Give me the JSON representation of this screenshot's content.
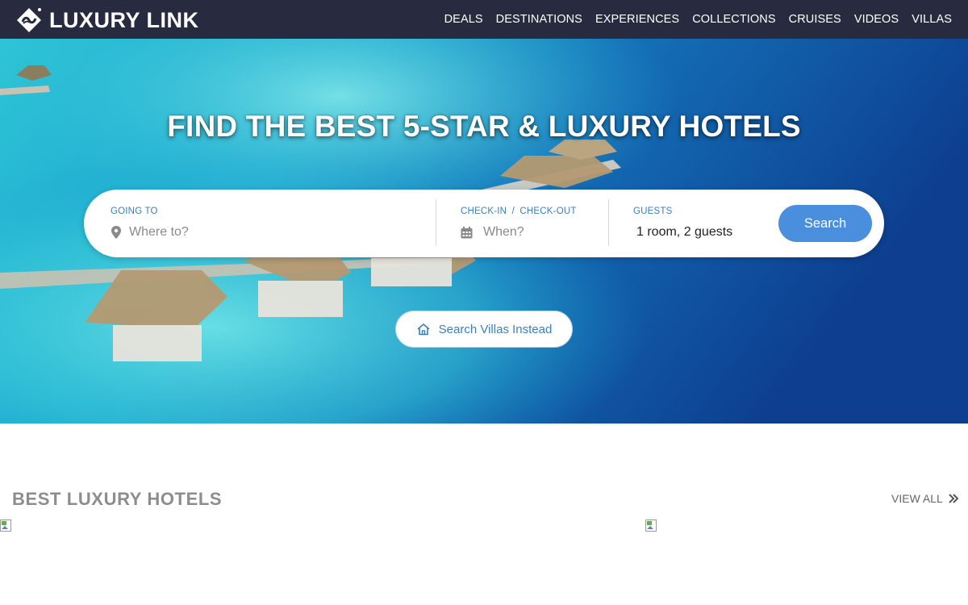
{
  "brand": {
    "name": "LUXURY LINK",
    "logo_icon": "luxury-link-logo-icon"
  },
  "nav": {
    "items": [
      {
        "label": "DEALS"
      },
      {
        "label": "DESTINATIONS"
      },
      {
        "label": "EXPERIENCES"
      },
      {
        "label": "COLLECTIONS"
      },
      {
        "label": "CRUISES"
      },
      {
        "label": "VIDEOS"
      },
      {
        "label": "VILLAS"
      }
    ]
  },
  "hero": {
    "title": "FIND THE BEST 5-STAR & LUXURY HOTELS",
    "search": {
      "going_to": {
        "label": "GOING TO",
        "placeholder": "Where to?",
        "icon": "map-pin-icon"
      },
      "dates": {
        "label_checkin": "CHECK-IN",
        "separator": "/",
        "label_checkout": "CHECK-OUT",
        "placeholder": "When?",
        "icon": "calendar-icon"
      },
      "guests": {
        "label": "GUESTS",
        "value": "1 room, 2 guests"
      },
      "button": "Search"
    },
    "villas_button": {
      "label": "Search Villas Instead",
      "icon": "home-icon"
    }
  },
  "section": {
    "title": "BEST LUXURY HOTELS",
    "view_all": "VIEW ALL",
    "view_all_icon": "double-chevron-right-icon"
  },
  "colors": {
    "nav_bg": "#282b3f",
    "accent": "#4a8fde",
    "label_blue": "#3a7fc2",
    "section_title": "#8d8d8d"
  }
}
